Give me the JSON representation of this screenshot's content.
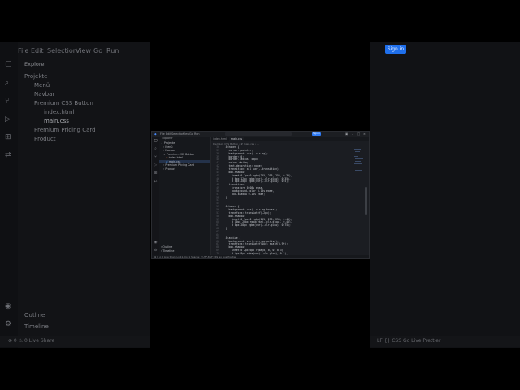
{
  "background": {
    "menu": [
      "File",
      "Edit",
      "Selection",
      "View",
      "Go",
      "Run"
    ],
    "explorer_title": "Explorer",
    "tree": [
      "Projekte",
      "Menü",
      "Navbar",
      "Premium CSS Button",
      "index.html",
      "main.css",
      "Premium Pricing Card",
      "Product"
    ],
    "bottom": [
      "Outline",
      "Timeline"
    ],
    "status_left": "⊗ 0 ⚠ 0   Live Share",
    "status_right": "LF  {}  CSS  Go Live  Prettier",
    "signin": "Sign in"
  },
  "window": {
    "menu": [
      "File",
      "Edit",
      "Selection",
      "View",
      "Go",
      "Run"
    ],
    "signin_label": "Sign in",
    "sidebar_title": "Explorer",
    "tree": [
      {
        "label": "Projekte",
        "indent": 0,
        "icon": "⌄"
      },
      {
        "label": "Menü",
        "indent": 1,
        "icon": "›"
      },
      {
        "label": "Navbar",
        "indent": 1,
        "icon": "›"
      },
      {
        "label": "Premium CSS Button",
        "indent": 1,
        "icon": "⌄"
      },
      {
        "label": "index.html",
        "indent": 2,
        "icon": "◇"
      },
      {
        "label": "main.css",
        "indent": 2,
        "icon": "#",
        "selected": true
      },
      {
        "label": "Premium Pricing Card",
        "indent": 1,
        "icon": "›"
      },
      {
        "label": "Product",
        "indent": 1,
        "icon": "›"
      }
    ],
    "outline": "› Outline",
    "timeline": "› Timeline",
    "tabs": [
      "index.html",
      "main.css"
    ],
    "breadcrumb": "Premium CSS Button › # main.css › ...",
    "status": "⊗ 0 ⚠ 0   Live Share        Ln 11, Col 1   Spaces: 2   UTF-8   LF   CSS   Go Live   Prettier",
    "code": [
      {
        "n": "36",
        "t": "  &:hover {"
      },
      {
        "n": "37",
        "t": "    cursor: pointer;"
      },
      {
        "n": "38",
        "t": "    background: var(--clr-bg);"
      },
      {
        "n": "39",
        "t": "    border: 0;"
      },
      {
        "n": "40",
        "t": "    border-radius: 50px;"
      },
      {
        "n": "41",
        "t": "    color: white;"
      },
      {
        "n": "42",
        "t": "    text-decoration: none;"
      },
      {
        "n": "43",
        "t": "    transition: all var(--transition);"
      },
      {
        "n": "44",
        "t": "    box-shadow:"
      },
      {
        "n": "45",
        "t": "      inset 0 1px 0 rgba(255, 255, 255, 0.35),"
      },
      {
        "n": "46",
        "t": "      0 6px 12px rgba(var(--clr-glow), 0.35),"
      },
      {
        "n": "47",
        "t": "      0 0px 20px rgba(var(--clr-glow), 0.5);"
      },
      {
        "n": "48",
        "t": "    transition:"
      },
      {
        "n": "49",
        "t": "      transform 0.08s ease,"
      },
      {
        "n": "50",
        "t": "      background-color 0.15s ease,"
      },
      {
        "n": "51",
        "t": "      box-shadow 0.15s ease;"
      },
      {
        "n": "52",
        "t": "  }"
      },
      {
        "n": "53",
        "t": ""
      },
      {
        "n": "54",
        "t": ""
      },
      {
        "n": "55",
        "t": "  &:hover {"
      },
      {
        "n": "56",
        "t": "    background: var(--clr-bg-hover);"
      },
      {
        "n": "57",
        "t": "    transform: translateY(-2px);"
      },
      {
        "n": "58",
        "t": "    box-shadow:"
      },
      {
        "n": "59",
        "t": "      inset 0 1px 0 rgba(255, 255, 255, 0.45),"
      },
      {
        "n": "60",
        "t": "      0 10px 20px rgba(var(--clr-glow), 0.45),"
      },
      {
        "n": "61",
        "t": "      0 0px 28px rgba(var(--clr-glow), 0.75);"
      },
      {
        "n": "62",
        "t": "  }"
      },
      {
        "n": "63",
        "t": ""
      },
      {
        "n": "64",
        "t": ""
      },
      {
        "n": "65",
        "t": "  &:active {"
      },
      {
        "n": "66",
        "t": "    background: var(--clr-bg-active);"
      },
      {
        "n": "67",
        "t": "    transform: translateY(1px) scale(0.99);"
      },
      {
        "n": "68",
        "t": "    box-shadow:"
      },
      {
        "n": "69",
        "t": "      inset 0 2px 6px rgba(0, 0, 0, 0.3),"
      },
      {
        "n": "70",
        "t": "      0 4px 8px rgba(var(--clr-glow), 0.3),"
      }
    ]
  }
}
